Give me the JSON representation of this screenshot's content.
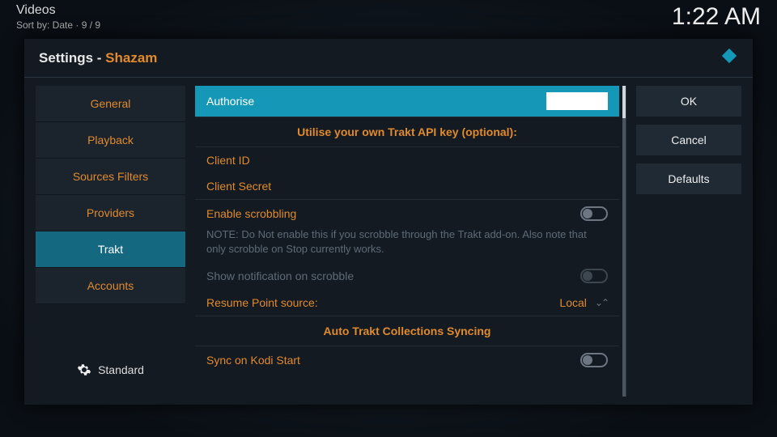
{
  "topbar": {
    "section": "Videos",
    "sortline": "Sort by: Date  ·  9 / 9",
    "time": "1:22 AM"
  },
  "dialog": {
    "title_prefix": "Settings - ",
    "title_addon": "Shazam"
  },
  "sidebar": {
    "items": [
      {
        "label": "General"
      },
      {
        "label": "Playback"
      },
      {
        "label": "Sources Filters"
      },
      {
        "label": "Providers"
      },
      {
        "label": "Trakt",
        "selected": true
      },
      {
        "label": "Accounts"
      }
    ],
    "level": "Standard"
  },
  "content": {
    "authorise": "Authorise",
    "heading_api": "Utilise your own Trakt API key (optional):",
    "client_id": "Client ID",
    "client_secret": "Client Secret",
    "enable_scrobbling": "Enable scrobbling",
    "scrobble_note": "NOTE: Do Not enable this if you scrobble through the Trakt add-on. Also note that only scrobble on Stop currently works.",
    "show_notif": "Show notification on scrobble",
    "resume_label": "Resume Point source:",
    "resume_value": "Local",
    "heading_sync": "Auto Trakt Collections Syncing",
    "sync_on_start": "Sync on Kodi Start"
  },
  "actions": {
    "ok": "OK",
    "cancel": "Cancel",
    "defaults": "Defaults"
  }
}
